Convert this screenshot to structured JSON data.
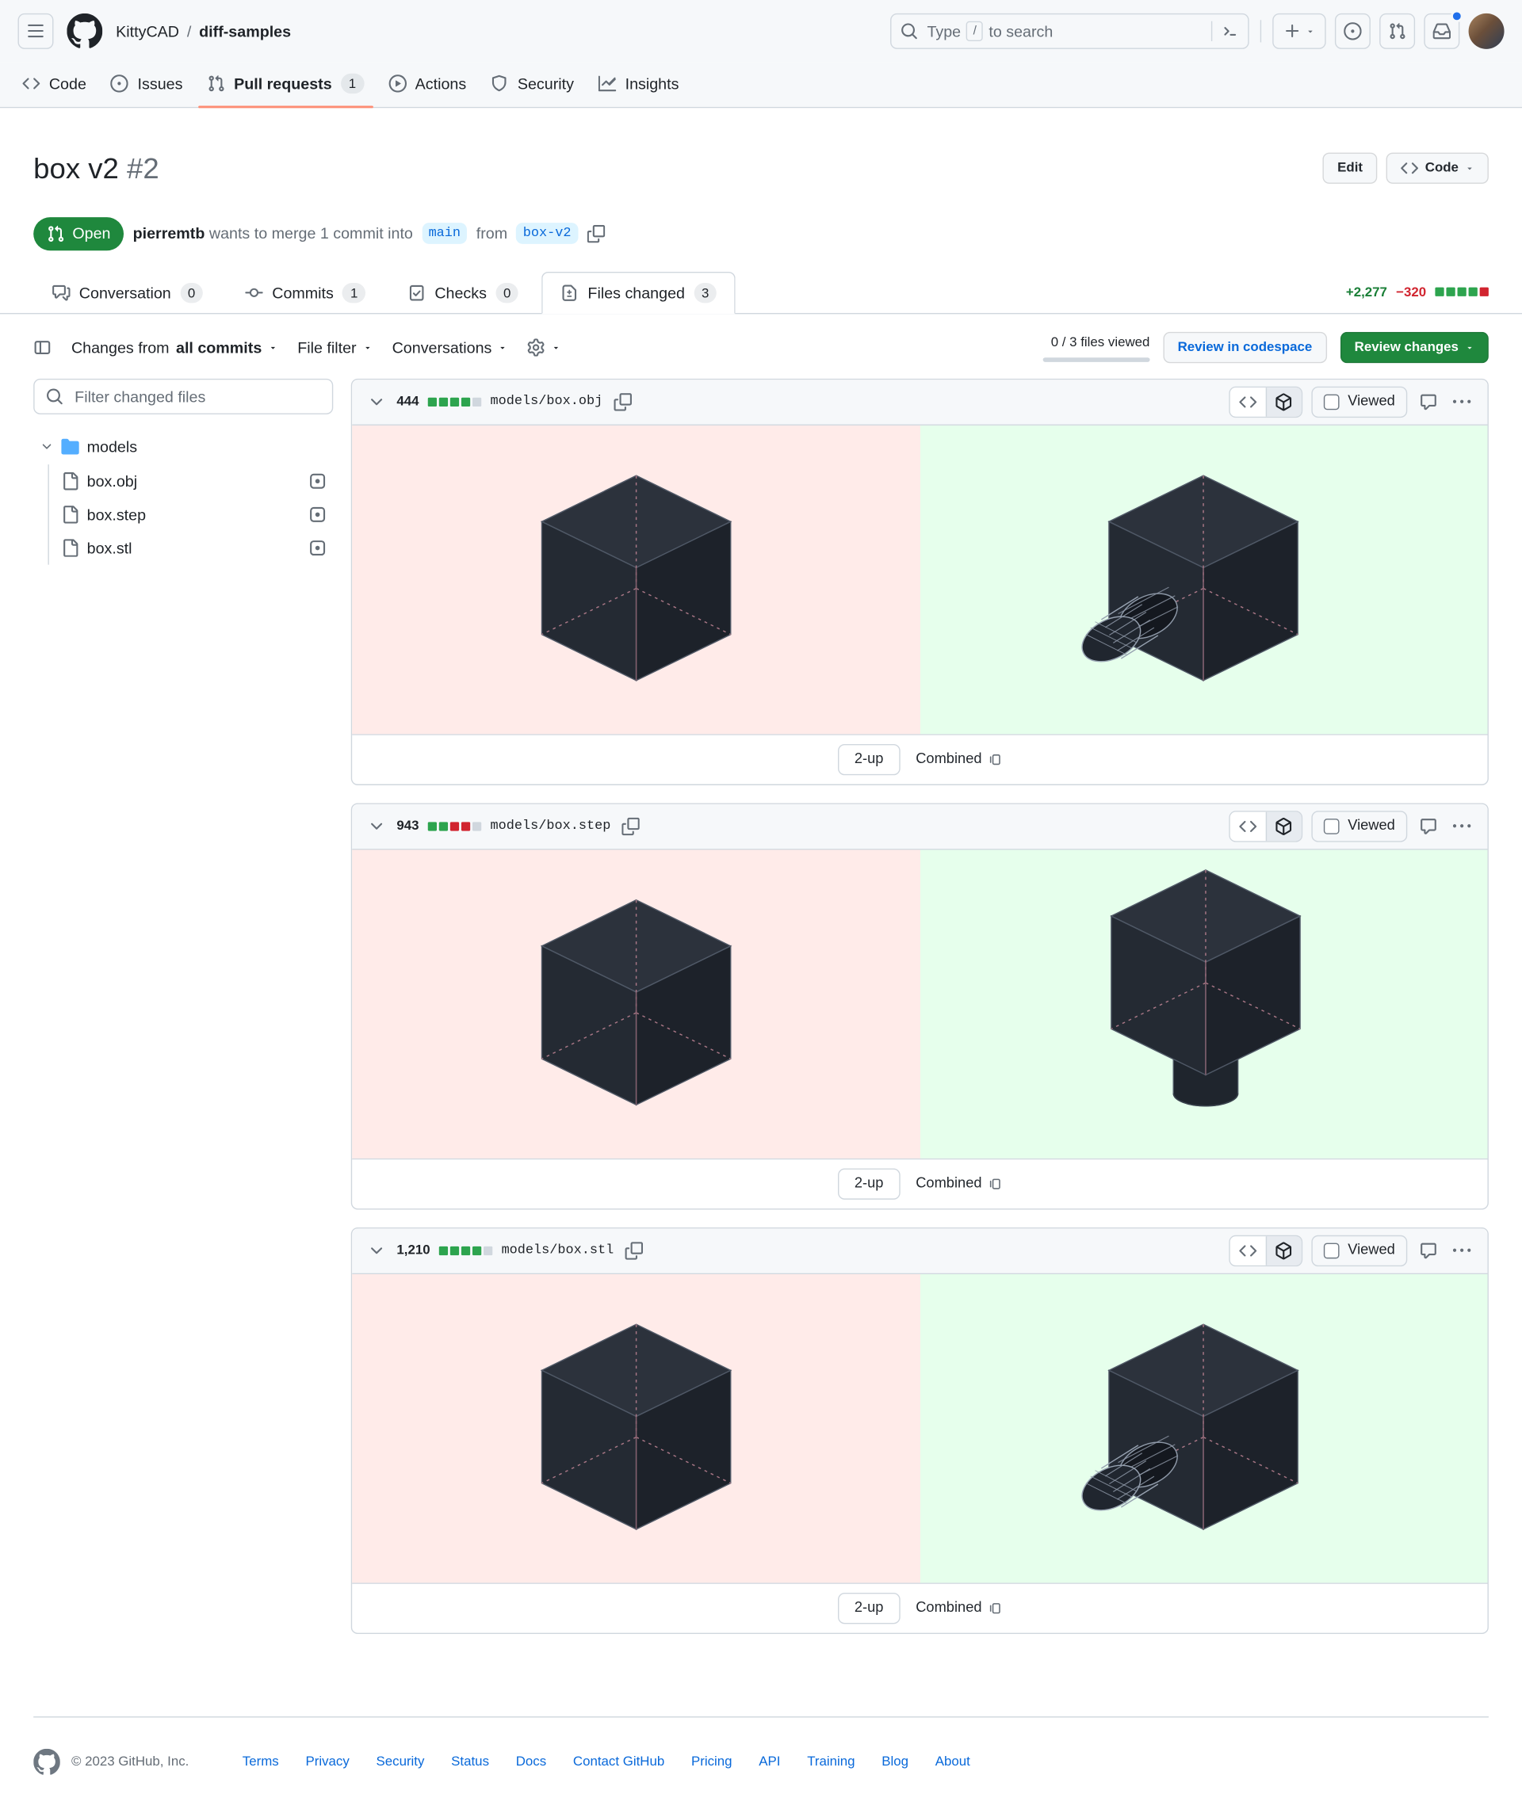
{
  "header": {
    "owner": "KittyCAD",
    "path_separator": "/",
    "repo": "diff-samples",
    "search_pre": "Type",
    "search_slash": "/",
    "search_post": "to search"
  },
  "repo_nav": {
    "items": [
      {
        "label": "Code"
      },
      {
        "label": "Issues"
      },
      {
        "label": "Pull requests",
        "count": "1"
      },
      {
        "label": "Actions"
      },
      {
        "label": "Security"
      },
      {
        "label": "Insights"
      }
    ]
  },
  "pr_header": {
    "title": "box v2",
    "number": "#2",
    "edit_button": "Edit",
    "code_button": "Code",
    "state_badge": "Open",
    "author": "pierremtb",
    "merge_text": "wants to merge 1 commit into",
    "base_branch": "main",
    "from_text": "from",
    "head_branch": "box-v2"
  },
  "pr_tabs": {
    "conversation": {
      "label": "Conversation",
      "count": "0"
    },
    "commits": {
      "label": "Commits",
      "count": "1"
    },
    "checks": {
      "label": "Checks",
      "count": "0"
    },
    "files_changed": {
      "label": "Files changed",
      "count": "3"
    }
  },
  "diffstat": {
    "additions": "+2,277",
    "deletions": "−320",
    "blocks": [
      "added",
      "added",
      "added",
      "added",
      "deleted"
    ]
  },
  "toolbar": {
    "changes_from_label": "Changes from",
    "changes_from_value": "all commits",
    "file_filter_label": "File filter",
    "conversations_label": "Conversations",
    "files_viewed": "0 / 3 files viewed",
    "review_codespace_button": "Review in codespace",
    "review_changes_button": "Review changes"
  },
  "file_tree": {
    "filter_placeholder": "Filter changed files",
    "folder_label": "models",
    "items": [
      {
        "name": "box.obj"
      },
      {
        "name": "box.step"
      },
      {
        "name": "box.stl"
      }
    ]
  },
  "diffs": [
    {
      "changes": "444",
      "path": "models/box.obj",
      "viewed_label": "Viewed",
      "two_up_label": "2-up",
      "combined_label": "Combined",
      "blocks": [
        "added",
        "added",
        "added",
        "added",
        "neutral"
      ],
      "old_render": "solid dark cube",
      "new_render": "cube with cylindrical hole at lower-left"
    },
    {
      "changes": "943",
      "path": "models/box.step",
      "viewed_label": "Viewed",
      "two_up_label": "2-up",
      "combined_label": "Combined",
      "blocks": [
        "added",
        "added",
        "deleted",
        "deleted",
        "neutral"
      ],
      "old_render": "solid dark cube",
      "new_render": "cube with cylinder protruding from bottom"
    },
    {
      "changes": "1,210",
      "path": "models/box.stl",
      "viewed_label": "Viewed",
      "two_up_label": "2-up",
      "combined_label": "Combined",
      "blocks": [
        "added",
        "added",
        "added",
        "added",
        "neutral"
      ],
      "old_render": "solid dark cube",
      "new_render": "cube with cylindrical hole at lower-left"
    }
  ],
  "footer": {
    "copyright": "© 2023 GitHub, Inc.",
    "links": [
      "Terms",
      "Privacy",
      "Security",
      "Status",
      "Docs",
      "Contact GitHub",
      "Pricing",
      "API",
      "Training",
      "Blog",
      "About"
    ]
  },
  "colors": {
    "accent_green": "#1f883d",
    "additions_green": "#1a7f37",
    "deletions_red": "#d1242f",
    "tab_underline": "#fd8c73",
    "branch_chip_bg": "#ddf4ff",
    "branch_chip_text": "#0969da",
    "old_diff_bg": "#ffebe9",
    "new_diff_bg": "#e6ffec"
  }
}
